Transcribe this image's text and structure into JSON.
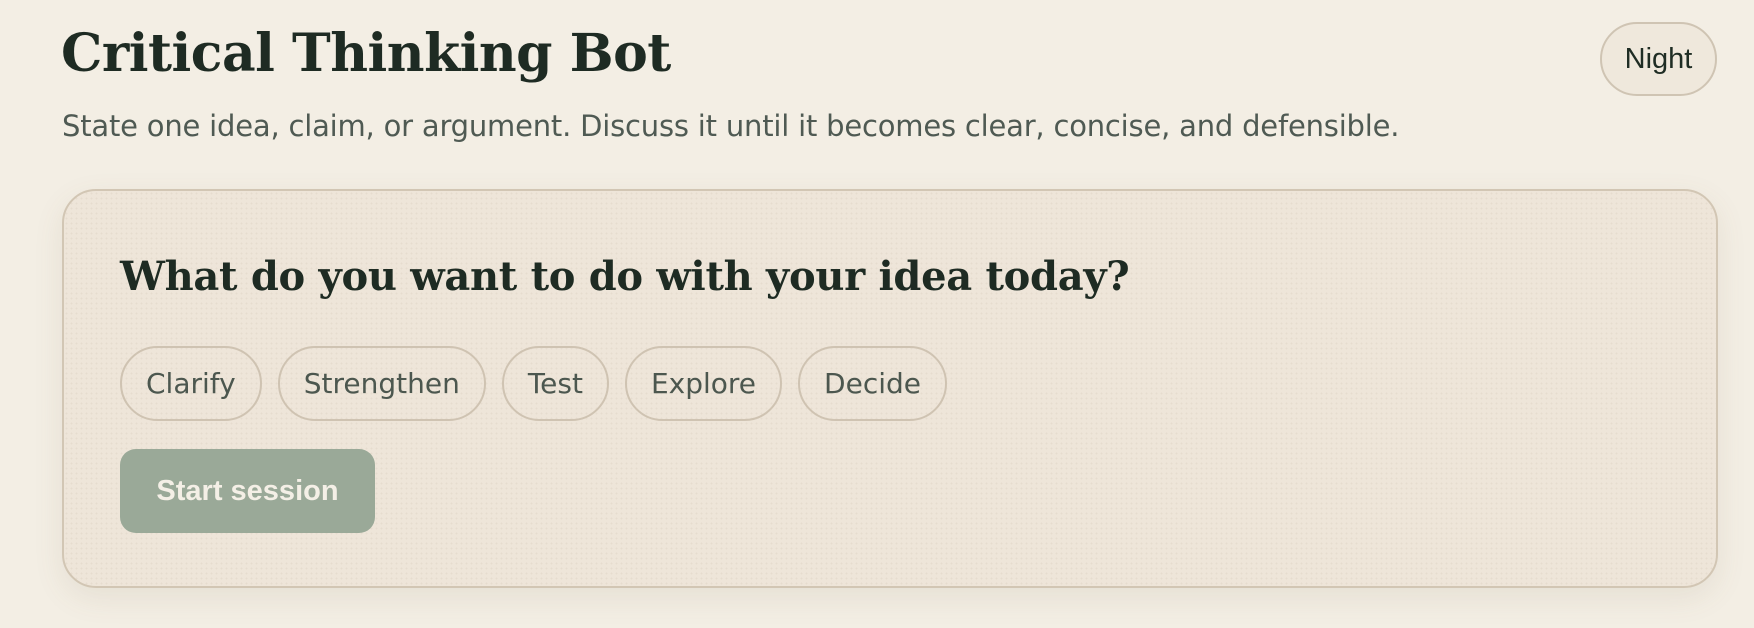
{
  "header": {
    "title": "Critical Thinking Bot",
    "subtitle": "State one idea, claim, or argument. Discuss it until it becomes clear, concise, and defensible.",
    "theme_toggle_label": "Night"
  },
  "card": {
    "question": "What do you want to do with your idea today?",
    "options": [
      {
        "label": "Clarify"
      },
      {
        "label": "Strengthen"
      },
      {
        "label": "Test"
      },
      {
        "label": "Explore"
      },
      {
        "label": "Decide"
      }
    ],
    "start_button_label": "Start session",
    "start_button_disabled": true
  },
  "colors": {
    "background": "#f3eee4",
    "card_background": "#eee5d9",
    "heading_text": "#1e2b23",
    "body_text": "#4f5a53",
    "start_button_disabled": "#9aa998",
    "border": "#cfc4b3"
  }
}
